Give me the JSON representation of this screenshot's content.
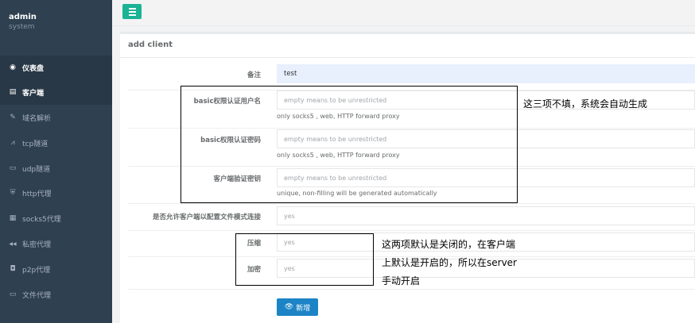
{
  "profile": {
    "user": "admin",
    "role": "system"
  },
  "menu": {
    "toggle_icon": "hamburger-icon"
  },
  "sidebar": {
    "items": [
      {
        "label": "仪表盘",
        "icon": "dashboard-icon",
        "glyph": "◉"
      },
      {
        "label": "客户端",
        "icon": "clipboard-icon",
        "glyph": "▤"
      },
      {
        "label": "域名解析",
        "icon": "link-icon",
        "glyph": "✎"
      },
      {
        "label": "tcp隧道",
        "icon": "chart-icon",
        "glyph": "⩘"
      },
      {
        "label": "udp隧道",
        "icon": "hdd-icon",
        "glyph": "▭"
      },
      {
        "label": "http代理",
        "icon": "shield-icon",
        "glyph": "⛨"
      },
      {
        "label": "socks5代理",
        "icon": "table-icon",
        "glyph": "▦"
      },
      {
        "label": "私密代理",
        "icon": "backward-icon",
        "glyph": "◀◀"
      },
      {
        "label": "p2p代理",
        "icon": "clone-icon",
        "glyph": "◘"
      },
      {
        "label": "文件代理",
        "icon": "laptop-icon",
        "glyph": "▭"
      }
    ]
  },
  "panel": {
    "title": "add client"
  },
  "form": {
    "remark": {
      "label": "备注",
      "value": "test"
    },
    "basic_user": {
      "label": "basic权限认证用户名",
      "placeholder": "empty means to be unrestricted",
      "help": "only socks5 , web, HTTP forward proxy"
    },
    "basic_pass": {
      "label": "basic权限认证密码",
      "placeholder": "empty means to be unrestricted",
      "help": "only socks5 , web, HTTP forward proxy"
    },
    "vkey": {
      "label": "客户端验证密钥",
      "placeholder": "empty means to be unrestricted",
      "help": "unique, non-filling will be generated automatically"
    },
    "config_conn": {
      "label": "是否允许客户端以配置文件模式连接",
      "value": "yes"
    },
    "compress": {
      "label": "压缩",
      "value": "yes"
    },
    "crypt": {
      "label": "加密",
      "value": "yes"
    },
    "submit": {
      "label": "新增",
      "icon": "eye-icon"
    }
  },
  "annotations": {
    "note1": "这三项不填，系统会自动生成",
    "note2_line1": "这两项默认是关闭的，在客户端",
    "note2_line2": "上默认是开启的，所以在server",
    "note2_line3": "手动开启"
  }
}
